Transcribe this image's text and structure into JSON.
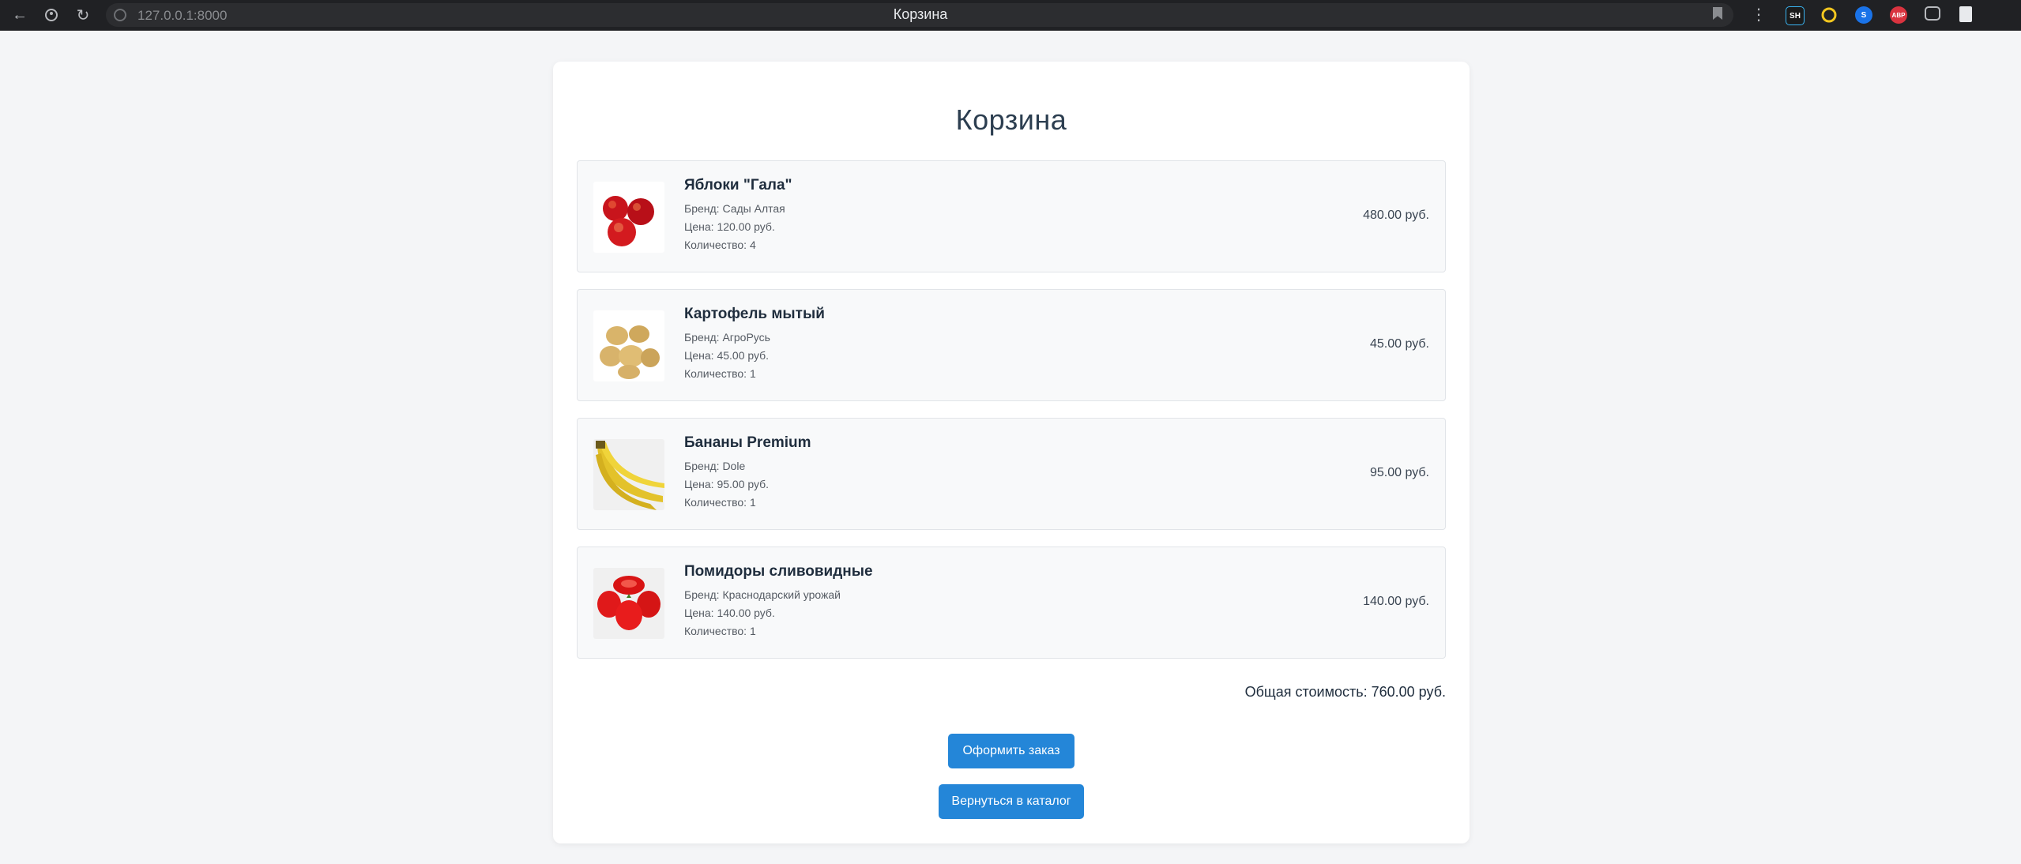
{
  "browser": {
    "url": "127.0.0.1:8000",
    "tab_title": "Корзина"
  },
  "page": {
    "heading": "Корзина"
  },
  "cart": {
    "items": [
      {
        "name": "Яблоки \"Гала\"",
        "brand": "Бренд: Сады Алтая",
        "price": "Цена: 120.00 руб.",
        "qty": "Количество: 4",
        "sum": "480.00 руб.",
        "image": "apples"
      },
      {
        "name": "Картофель мытый",
        "brand": "Бренд: АгроРусь",
        "price": "Цена: 45.00 руб.",
        "qty": "Количество: 1",
        "sum": "45.00 руб.",
        "image": "potatoes"
      },
      {
        "name": "Бананы Premium",
        "brand": "Бренд: Dole",
        "price": "Цена: 95.00 руб.",
        "qty": "Количество: 1",
        "sum": "95.00 руб.",
        "image": "bananas"
      },
      {
        "name": "Помидоры сливовидные",
        "brand": "Бренд: Краснодарский урожай",
        "price": "Цена: 140.00 руб.",
        "qty": "Количество: 1",
        "sum": "140.00 руб.",
        "image": "tomatoes"
      }
    ],
    "total": "Общая стоимость: 760.00 руб."
  },
  "actions": {
    "checkout_label": "Оформить заказ",
    "back_label": "Вернуться в каталог"
  },
  "colors": {
    "accent": "#2486d8",
    "background": "#f4f5f7"
  }
}
